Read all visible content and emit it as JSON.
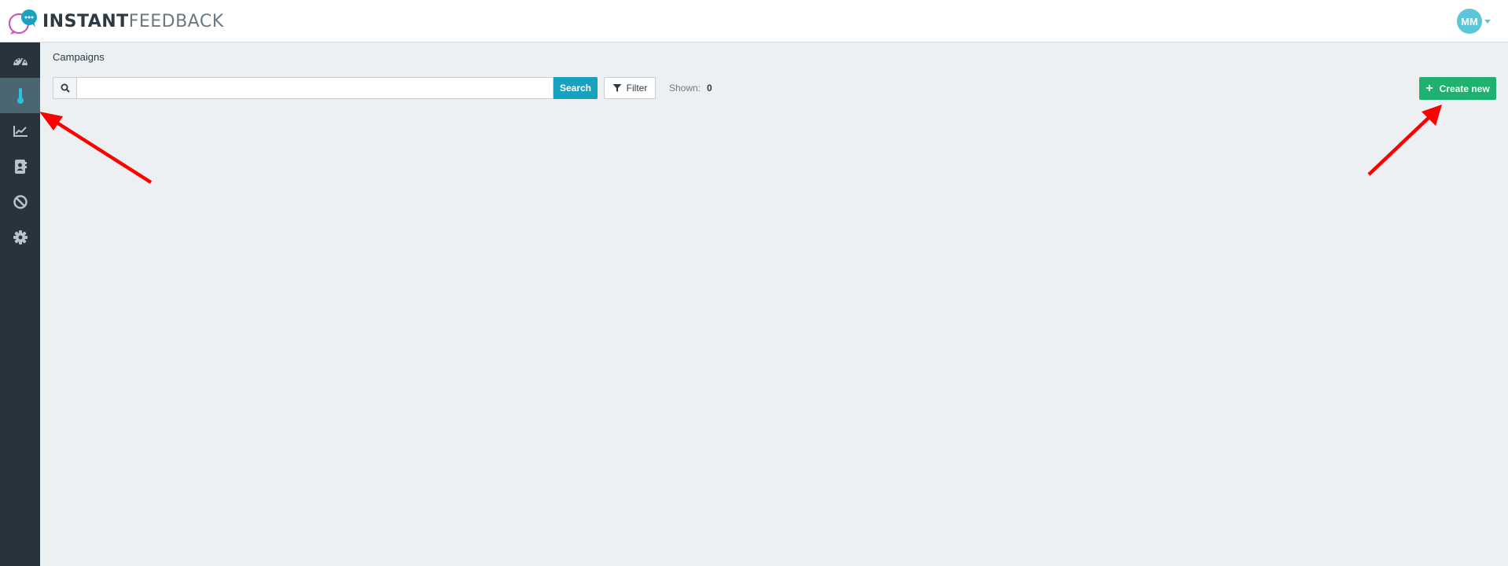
{
  "header": {
    "logo_bold": "INSTANT",
    "logo_light": "FEEDBACK",
    "user_initials": "MM"
  },
  "sidebar": {
    "items": [
      {
        "icon": "dashboard-gauge-icon",
        "active": false
      },
      {
        "icon": "thermometer-icon",
        "active": true
      },
      {
        "icon": "line-chart-icon",
        "active": false
      },
      {
        "icon": "contacts-book-icon",
        "active": false
      },
      {
        "icon": "ban-icon",
        "active": false
      },
      {
        "icon": "gear-icon",
        "active": false
      }
    ]
  },
  "main": {
    "title": "Campaigns",
    "search": {
      "value": "",
      "placeholder": "",
      "button_label": "Search"
    },
    "filter_label": "Filter",
    "shown_label": "Shown:",
    "shown_count": "0",
    "create_label": "Create new"
  },
  "colors": {
    "sidebar_bg": "#27343b",
    "sidebar_active": "#4b6571",
    "accent_teal": "#17a2bf",
    "create_green": "#1fb171",
    "annotation_red": "#ff0000",
    "avatar_bg": "#5bc5d9"
  }
}
